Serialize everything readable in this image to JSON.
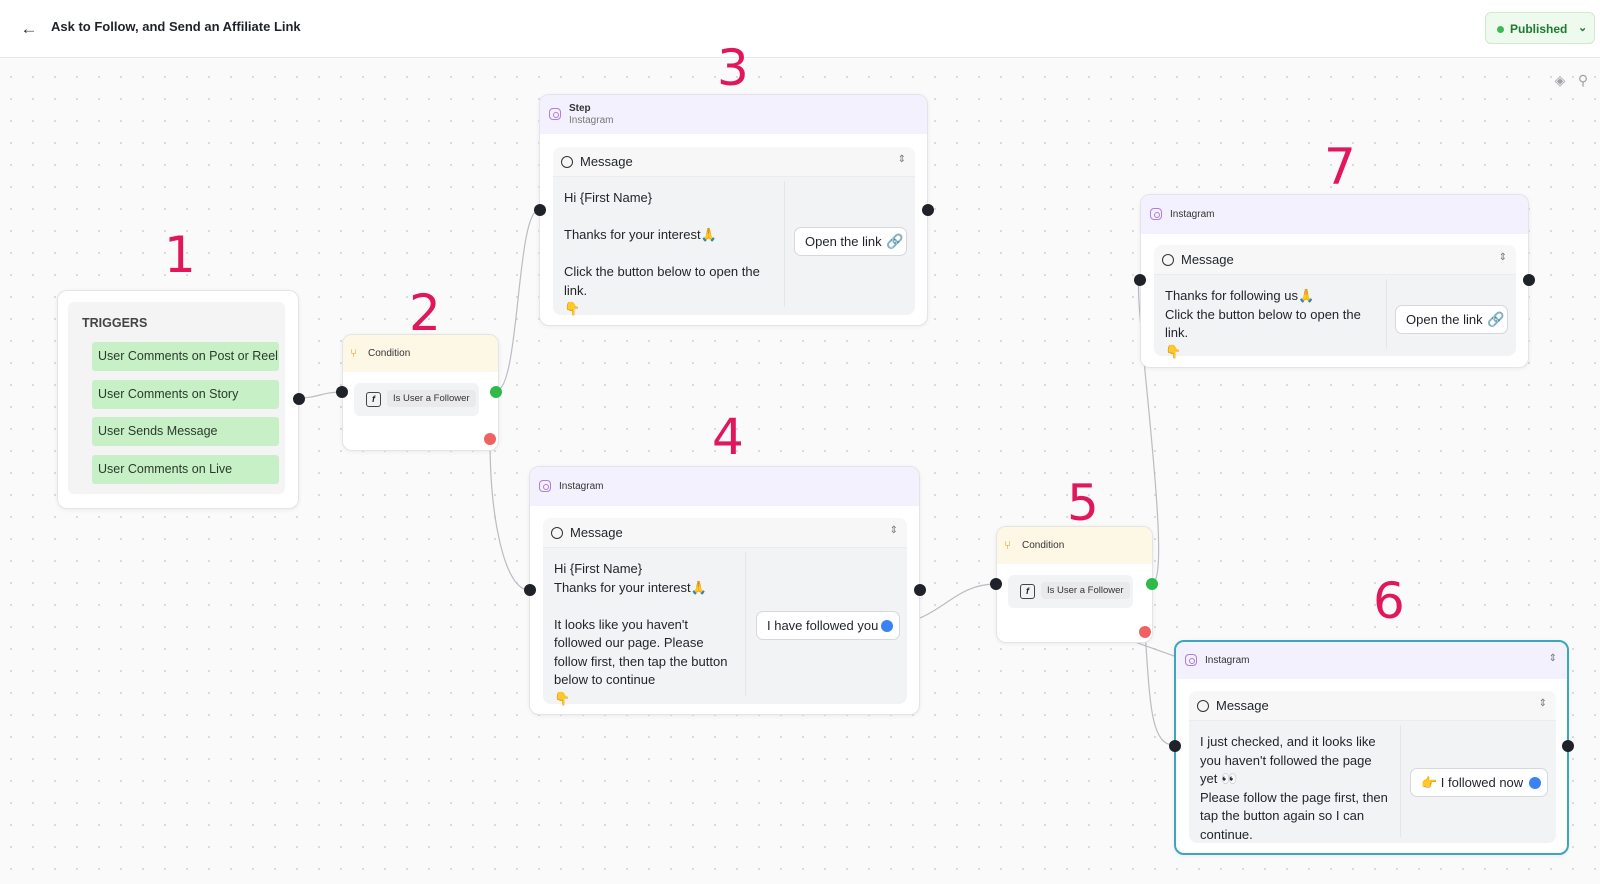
{
  "header": {
    "title": "Ask to Follow, and Send an Affiliate Link",
    "status": "Published"
  },
  "numbers": [
    "1",
    "2",
    "3",
    "4",
    "5",
    "6",
    "7"
  ],
  "triggers": {
    "title": "TRIGGERS",
    "items": [
      "User Comments on Post or Reel",
      "User Comments on Story",
      "User Sends Message",
      "User Comments on Live"
    ]
  },
  "condition_1": {
    "title": "Condition",
    "rule": "Is User a Follower"
  },
  "condition_2": {
    "title": "Condition",
    "rule": "Is User a Follower"
  },
  "step_3": {
    "title": "Step",
    "subtitle": "Instagram",
    "message_label": "Message",
    "text": "Hi {First Name}\n\nThanks for your interest🙏\n\nClick the button below to open the link.\n👇",
    "button": "Open the link"
  },
  "step_4": {
    "title": "Instagram",
    "message_label": "Message",
    "text": "Hi {First Name}\nThanks for your interest🙏\n\nIt looks like you haven't followed our page. Please follow first, then tap the button below to continue\n👇",
    "button": "I have followed you"
  },
  "step_6": {
    "title": "Instagram",
    "message_label": "Message",
    "text": "I just checked, and it looks like you haven't followed the page yet 👀\nPlease follow the page first, then tap the button again so I can continue.",
    "button": "👉 I followed now"
  },
  "step_7": {
    "title": "Instagram",
    "message_label": "Message",
    "text": "Thanks for following us🙏\nClick the button below to open the link.\n👇",
    "button": "Open the link"
  },
  "colors": {
    "accent_number": "#e0175a",
    "trigger_green": "#c8f0c6",
    "published_green": "#3cba54",
    "selected_border": "#3aa6c0",
    "handle_blue": "#3b82f6"
  },
  "icons": [
    "back-arrow-icon",
    "status-dot-icon",
    "chevron-down-icon",
    "layers-icon",
    "pin-icon",
    "instagram-icon",
    "chat-bubble-icon",
    "sort-arrows-icon",
    "link-icon",
    "condition-icon",
    "function-icon"
  ]
}
